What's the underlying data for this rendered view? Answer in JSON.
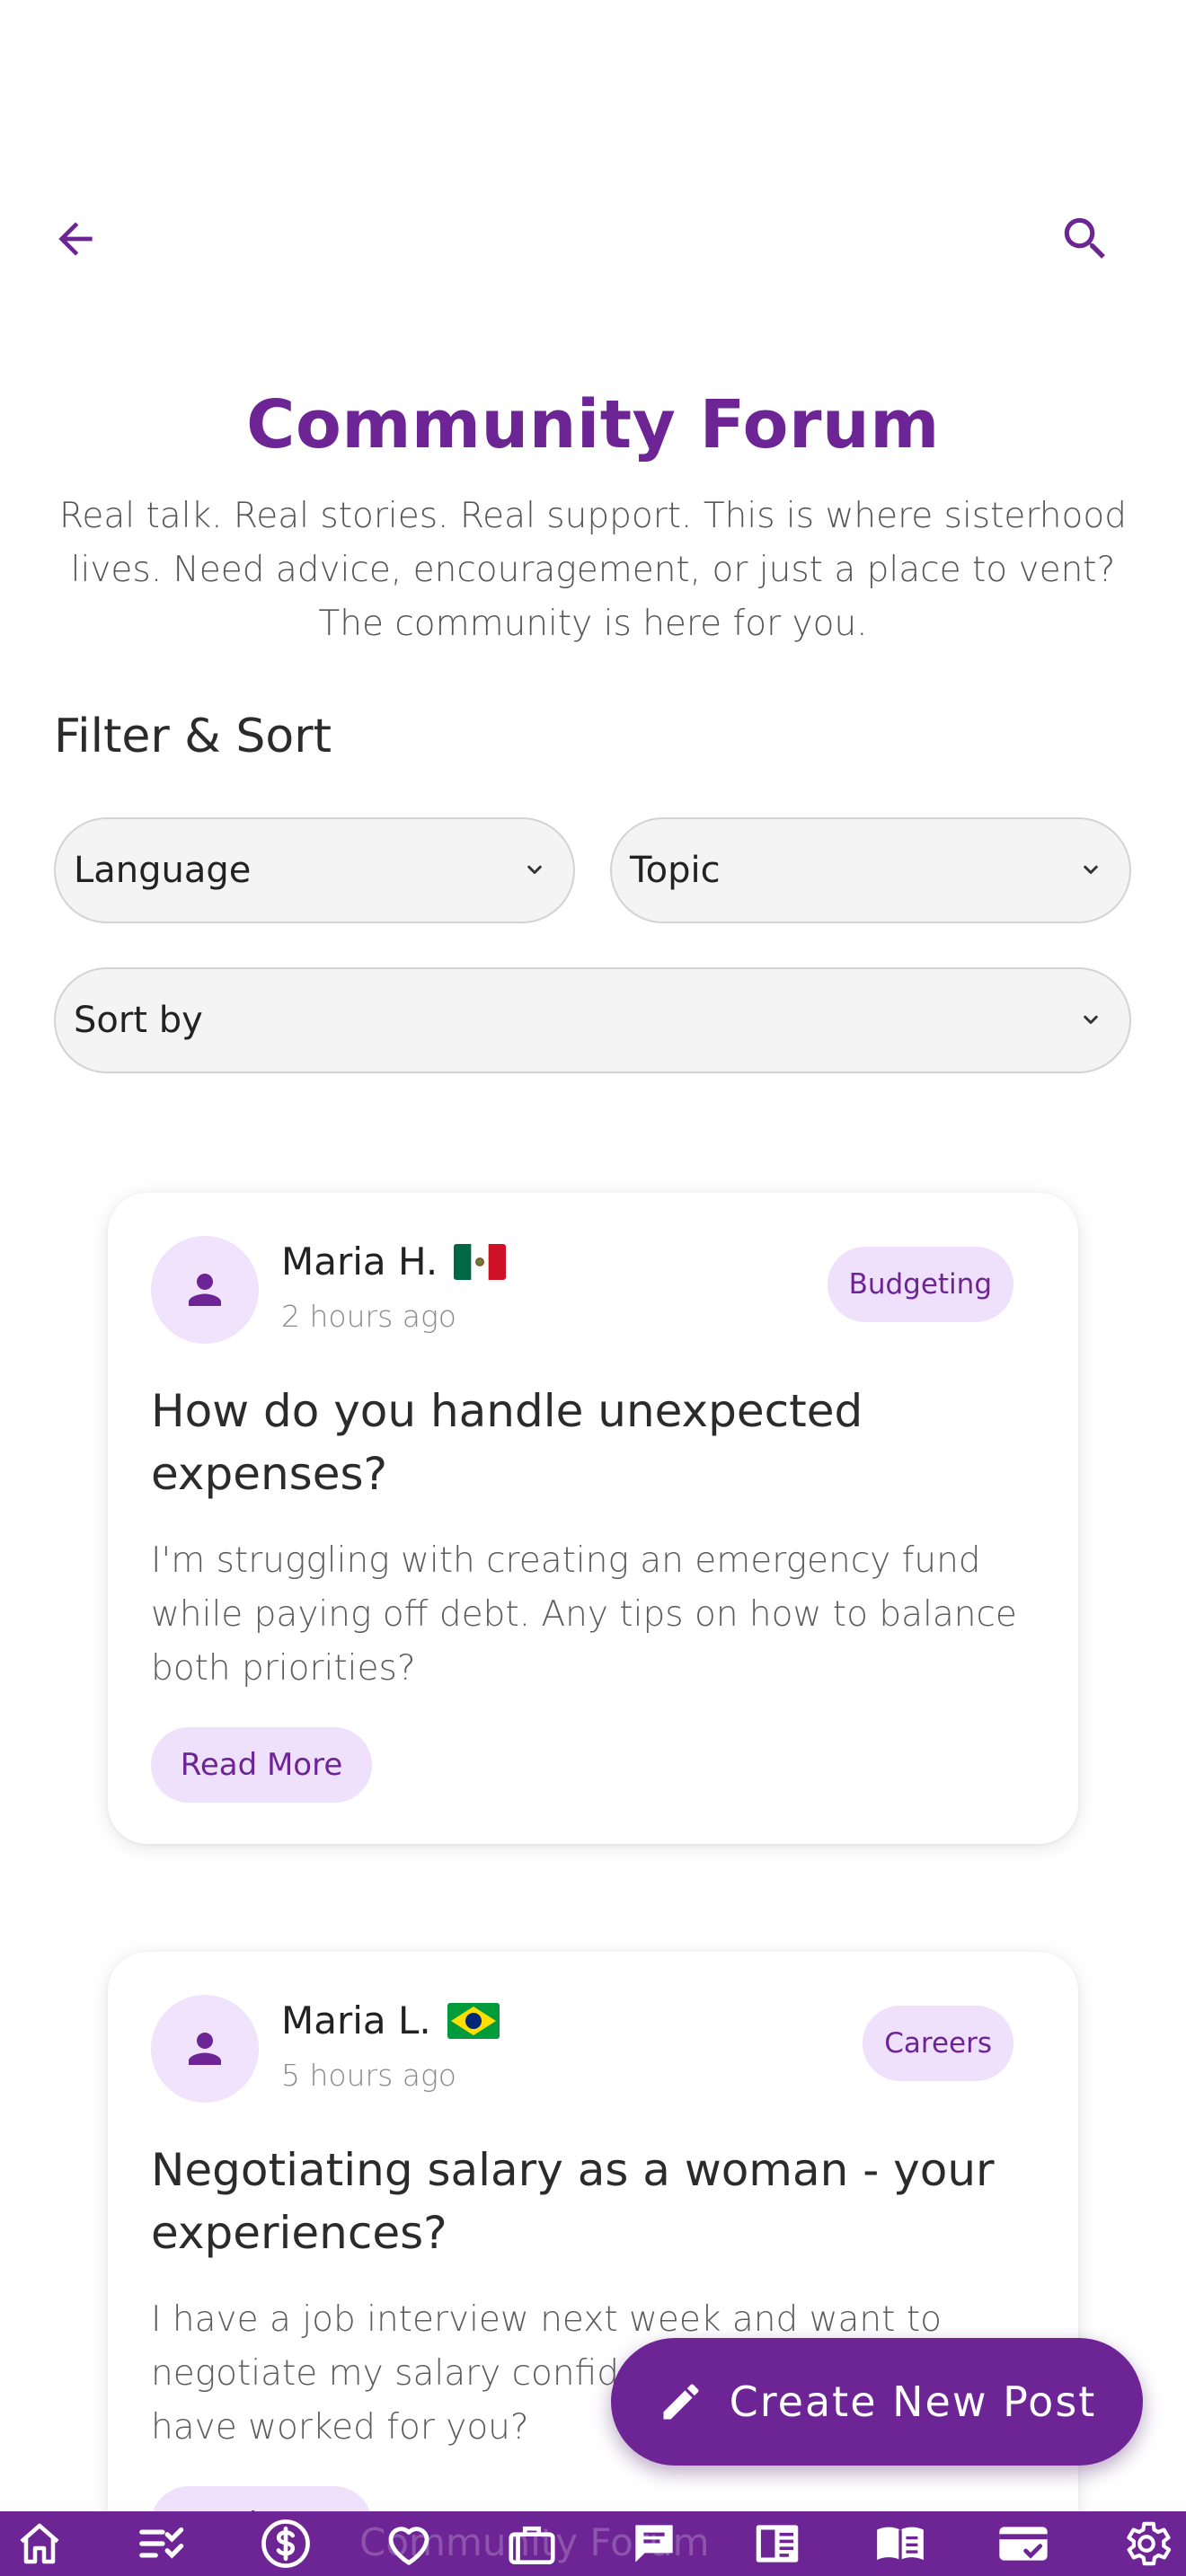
{
  "header": {
    "title": "Community Forum",
    "subtitle": "Real talk. Real stories. Real support. This is where sisterhood lives. Need advice, encouragement, or just a place to vent? The community is here for you."
  },
  "filters": {
    "heading": "Filter & Sort",
    "language_label": "Language",
    "topic_label": "Topic",
    "sort_label": "Sort by"
  },
  "posts": [
    {
      "author": "Maria H.",
      "flag": "mexico-flag",
      "time": "2 hours ago",
      "tag": "Budgeting",
      "title": "How do you handle unexpected expenses?",
      "body": "I'm struggling with creating an emergency fund while paying off debt. Any tips on how to balance both priorities?",
      "read_more": "Read More"
    },
    {
      "author": "Maria L.",
      "flag": "brazil-flag",
      "time": "5 hours ago",
      "tag": "Careers",
      "title": "Negotiating salary as a woman - your experiences?",
      "body": "I have a job interview next week and want to negotiate my salary confidently. What strategies have worked for you?",
      "read_more": "Read More"
    }
  ],
  "fab": {
    "label": "Create New Post"
  },
  "bottom_nav": {
    "ghost_label": "Community Forum",
    "items": [
      "home-icon",
      "checklist-icon",
      "dollar-icon",
      "heart-icon",
      "briefcase-icon",
      "chat-icon",
      "newspaper-icon",
      "book-icon",
      "card-check-icon",
      "gear-icon"
    ]
  },
  "colors": {
    "accent": "#6d2595",
    "tag_bg": "#efe0fb",
    "select_bg": "#f4f4f4"
  }
}
